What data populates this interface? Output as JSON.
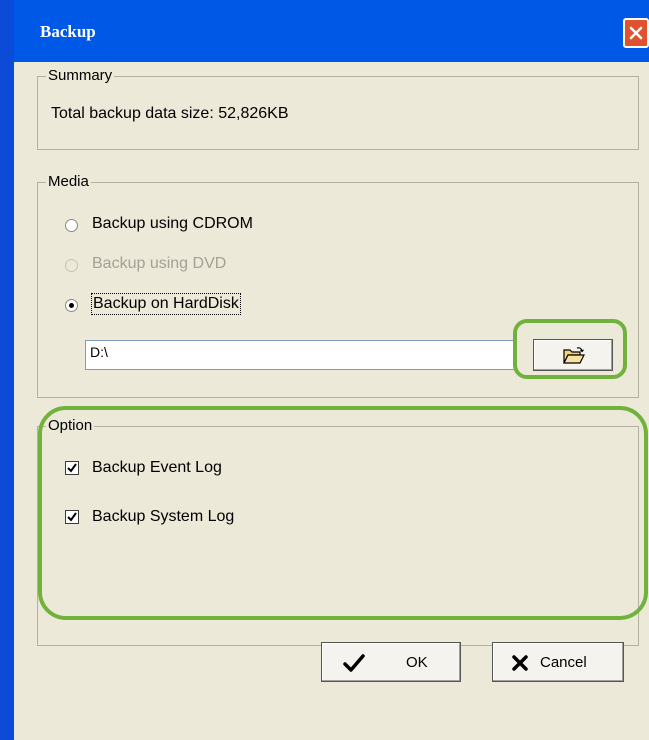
{
  "window": {
    "title": "Backup"
  },
  "summary": {
    "legend": "Summary",
    "total_size": "Total backup data size: 52,826KB"
  },
  "media": {
    "legend": "Media",
    "options": [
      {
        "label": "Backup using CDROM",
        "selected": false,
        "enabled": true
      },
      {
        "label": "Backup using DVD",
        "selected": false,
        "enabled": false
      },
      {
        "label": "Backup on HardDisk",
        "selected": true,
        "enabled": true
      }
    ],
    "path_value": "D:\\",
    "browse_icon": "folder-open-icon"
  },
  "option": {
    "legend": "Option",
    "checkboxes": [
      {
        "label": "Backup Event Log",
        "checked": true
      },
      {
        "label": "Backup System Log",
        "checked": true
      }
    ]
  },
  "buttons": {
    "ok_label": "OK",
    "cancel_label": "Cancel"
  },
  "colors": {
    "titlebar": "#0058e6",
    "dialog_bg": "#ece9d8",
    "highlight": "#70b23c",
    "close_button": "#e0522f"
  }
}
